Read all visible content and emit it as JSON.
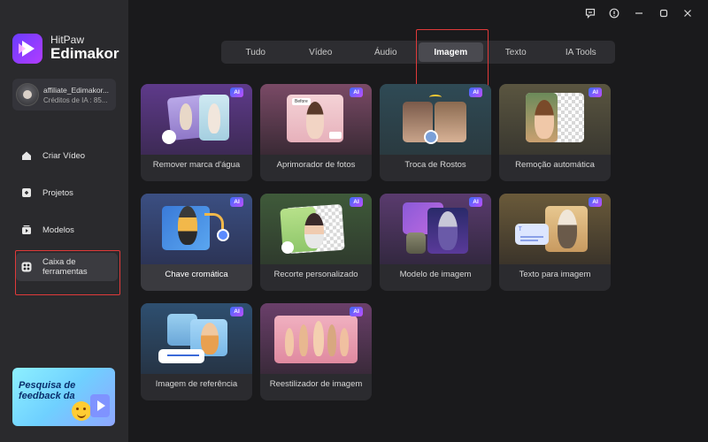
{
  "brand": {
    "top": "HitPaw",
    "name": "Edimakor"
  },
  "account": {
    "name": "affiliate_Edimakor...",
    "credits": "Créditos de IA : 85..."
  },
  "nav": [
    {
      "label": "Criar Vídeo",
      "icon": "home-icon"
    },
    {
      "label": "Projetos",
      "icon": "folder-icon"
    },
    {
      "label": "Modelos",
      "icon": "templates-icon"
    },
    {
      "label": "Caixa de ferramentas",
      "icon": "toolbox-icon"
    }
  ],
  "feedback": {
    "text": "Pesquisa de feedback da"
  },
  "tabs": [
    "Tudo",
    "Vídeo",
    "Áudio",
    "Imagem",
    "Texto",
    "IA Tools"
  ],
  "active_tab": "Imagem",
  "badge": "AI",
  "cards": [
    {
      "label": "Remover marca d'água"
    },
    {
      "label": "Aprimorador de fotos"
    },
    {
      "label": "Troca de Rostos"
    },
    {
      "label": "Remoção automática"
    },
    {
      "label": "Chave cromática"
    },
    {
      "label": "Recorte personalizado"
    },
    {
      "label": "Modelo de imagem"
    },
    {
      "label": "Texto para imagem"
    },
    {
      "label": "Imagem de referência"
    },
    {
      "label": "Reestilizador de imagem"
    }
  ],
  "thumb_text": {
    "before": "Before"
  },
  "colors": {
    "accent": "#6a3cff",
    "highlight": "#e03a3a",
    "sidebar": "#2a2a2d",
    "background": "#1a1a1c"
  }
}
